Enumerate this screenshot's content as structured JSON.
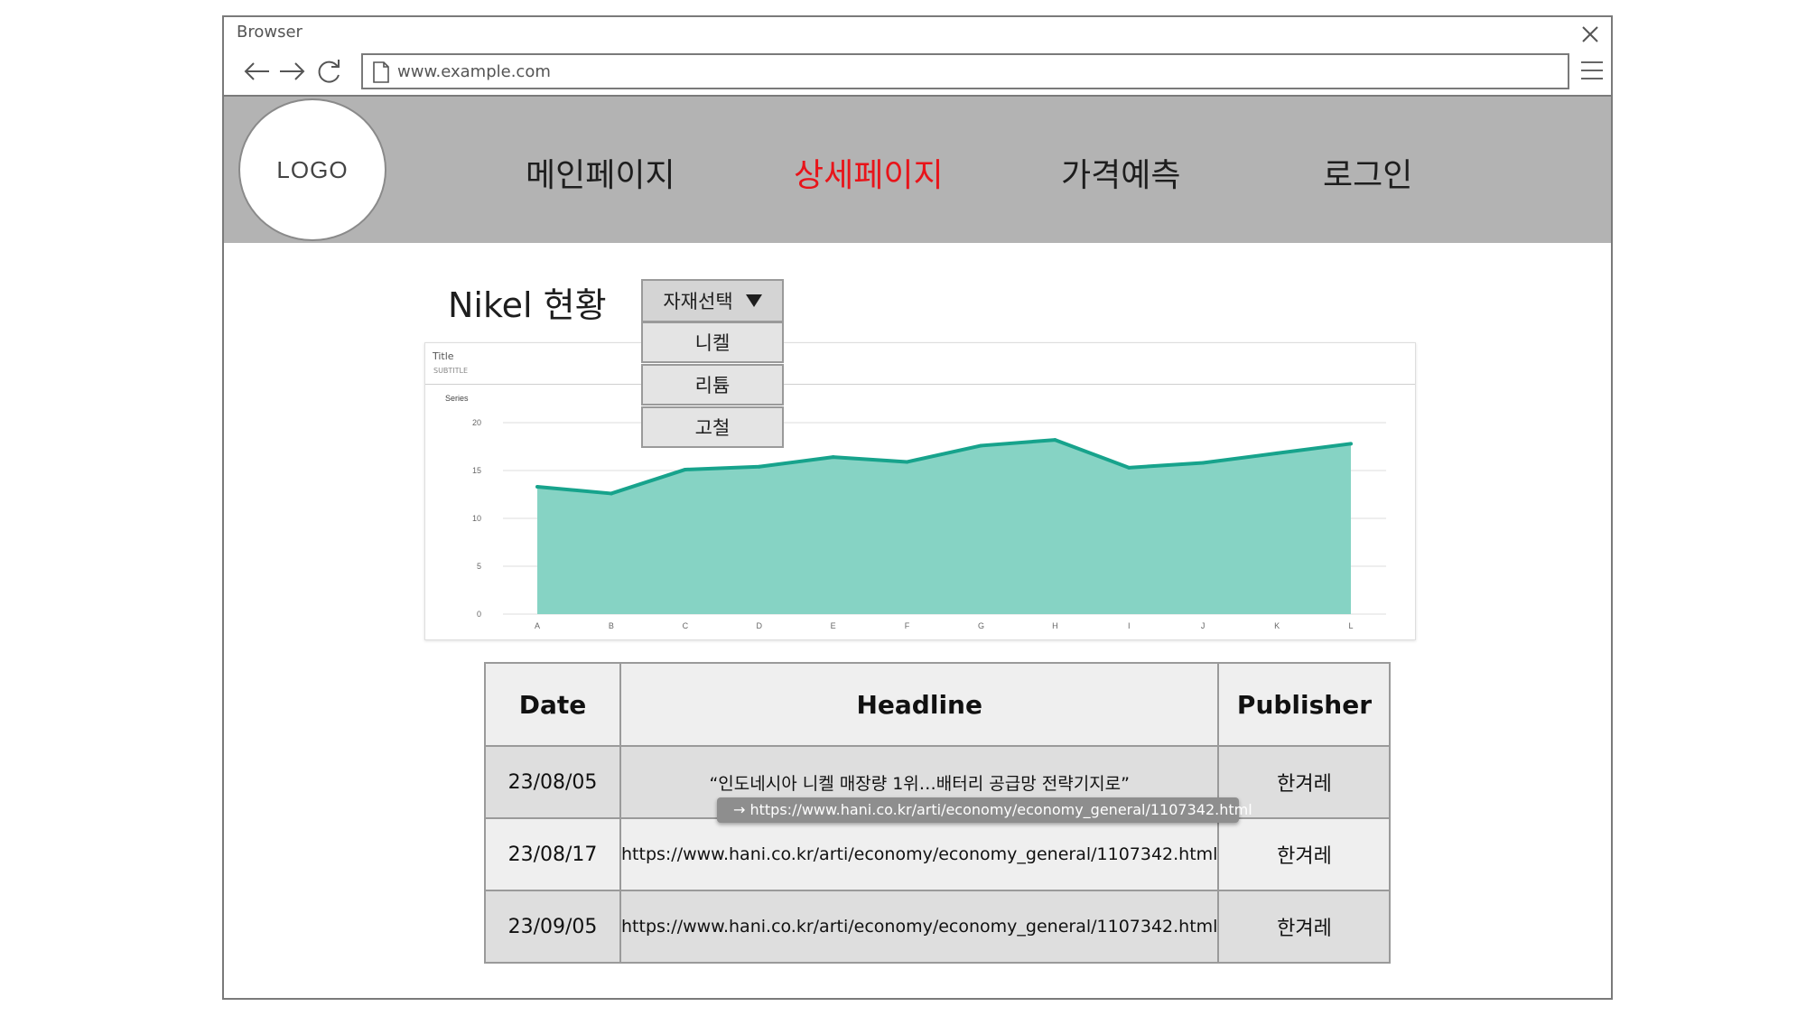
{
  "browser": {
    "title": "Browser",
    "url": "www.example.com"
  },
  "header": {
    "logo": "LOGO",
    "nav": [
      {
        "label": "메인페이지",
        "active": false
      },
      {
        "label": "상세페이지",
        "active": true
      },
      {
        "label": "가격예측",
        "active": false
      },
      {
        "label": "로그인",
        "active": false
      }
    ],
    "active_color": "#e8141a"
  },
  "main": {
    "title": "Nikel 현황",
    "dropdown": {
      "label": "자재선택",
      "options": [
        "니켈",
        "리튬",
        "고철"
      ]
    }
  },
  "chart_data": {
    "type": "area",
    "title": "Title",
    "subtitle": "SUBTITLE",
    "legend": [
      "Series"
    ],
    "series": [
      {
        "name": "Series",
        "values": [
          13.3,
          12.6,
          15.1,
          15.4,
          16.4,
          15.9,
          17.6,
          18.2,
          15.3,
          15.8,
          16.8,
          17.8
        ]
      }
    ],
    "categories": [
      "A",
      "B",
      "C",
      "D",
      "E",
      "F",
      "G",
      "H",
      "I",
      "J",
      "K",
      "L"
    ],
    "yticks": [
      0,
      5,
      10,
      15,
      20
    ],
    "ylim": [
      0,
      20
    ],
    "grid": true,
    "fill_color": "#86d3c4",
    "line_color": "#17a38c"
  },
  "table": {
    "headers": [
      "Date",
      "Headline",
      "Publisher"
    ],
    "rows": [
      {
        "date": "23/08/05",
        "headline": "“인도네시아 니켈 매장량 1위…배터리 공급망 전략기지로”",
        "publisher": "한겨레"
      },
      {
        "date": "23/08/17",
        "headline": "https://www.hani.co.kr/arti/economy/economy_general/1107342.html",
        "publisher": "한겨레"
      },
      {
        "date": "23/09/05",
        "headline": "https://www.hani.co.kr/arti/economy/economy_general/1107342.html",
        "publisher": "한겨레"
      }
    ]
  },
  "tooltip": {
    "text": "→ https://www.hani.co.kr/arti/economy/economy_general/1107342.html"
  }
}
